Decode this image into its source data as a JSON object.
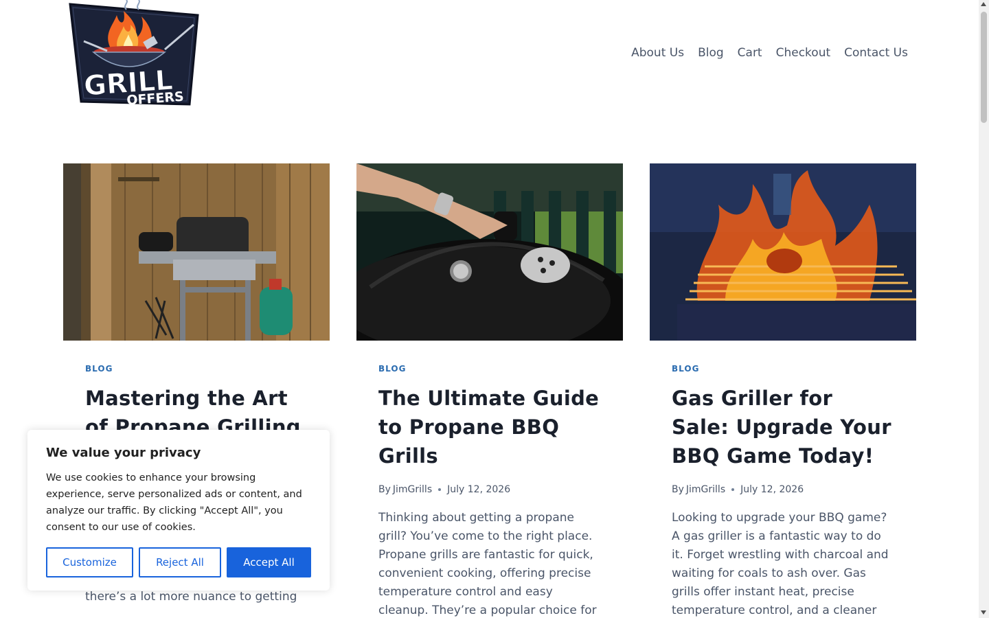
{
  "brand": {
    "logo_line1": "GRILL",
    "logo_line2": "OFFERS"
  },
  "nav": {
    "items": [
      "About Us",
      "Blog",
      "Cart",
      "Checkout",
      "Contact Us"
    ]
  },
  "posts": [
    {
      "category": "BLOG",
      "title": "Mastering the Art of Propane Grilling",
      "excerpt": "like a simple “turn it on and cook,” there’s a lot more nuance to getting"
    },
    {
      "category": "BLOG",
      "title": "The Ultimate Guide to Propane BBQ Grills",
      "by": "By",
      "author": "JimGrills",
      "date": "July 12, 2026",
      "excerpt": "Thinking about getting a propane grill? You’ve come to the right place. Propane grills are fantastic for quick, convenient cooking, offering precise temperature control and easy cleanup. They’re a popular choice for"
    },
    {
      "category": "BLOG",
      "title": "Gas Griller for Sale: Upgrade Your BBQ Game Today!",
      "by": "By",
      "author": "JimGrills",
      "date": "July 12, 2026",
      "excerpt": "Looking to upgrade your BBQ game? A gas griller is a fantastic way to do it. Forget wrestling with charcoal and waiting for coals to ash over. Gas grills offer instant heat, precise temperature control, and a cleaner"
    }
  ],
  "cookie": {
    "title": "We value your privacy",
    "text": "We use cookies to enhance your browsing experience, serve personalized ads or content, and analyze our traffic. By clicking \"Accept All\", you consent to our use of cookies.",
    "customize": "Customize",
    "reject": "Reject All",
    "accept": "Accept All"
  },
  "colors": {
    "accent": "#2b6cb0",
    "cookie_button": "#1863dc",
    "heading": "#1a202c",
    "body_text": "#4a5568"
  }
}
